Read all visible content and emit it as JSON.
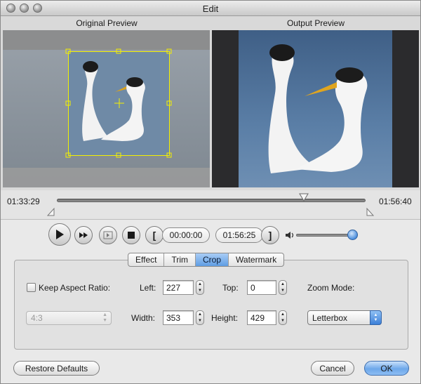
{
  "window": {
    "title": "Edit"
  },
  "preview": {
    "original_label": "Original Preview",
    "output_label": "Output Preview"
  },
  "timeline": {
    "start_time": "01:33:29",
    "end_time": "01:56:40",
    "playhead_fraction": 0.8
  },
  "controls": {
    "current_time": "00:00:00",
    "mark_out_time": "01:56:25",
    "mark_in_glyph": "[",
    "mark_out_glyph": "]",
    "volume_fraction": 0.95
  },
  "tabs": [
    {
      "label": "Effect",
      "active": false
    },
    {
      "label": "Trim",
      "active": false
    },
    {
      "label": "Crop",
      "active": true
    },
    {
      "label": "Watermark",
      "active": false
    }
  ],
  "crop": {
    "keep_aspect_label": "Keep Aspect Ratio:",
    "keep_aspect_checked": false,
    "aspect_value": "4:3",
    "left_label": "Left:",
    "left_value": "227",
    "top_label": "Top:",
    "top_value": "0",
    "width_label": "Width:",
    "width_value": "353",
    "height_label": "Height:",
    "height_value": "429",
    "zoom_mode_label": "Zoom Mode:",
    "zoom_mode_value": "Letterbox"
  },
  "buttons": {
    "restore_defaults": "Restore Defaults",
    "cancel": "Cancel",
    "ok": "OK"
  },
  "colors": {
    "crop_frame": "#f4f000",
    "accent_blue": "#5f9de3"
  }
}
